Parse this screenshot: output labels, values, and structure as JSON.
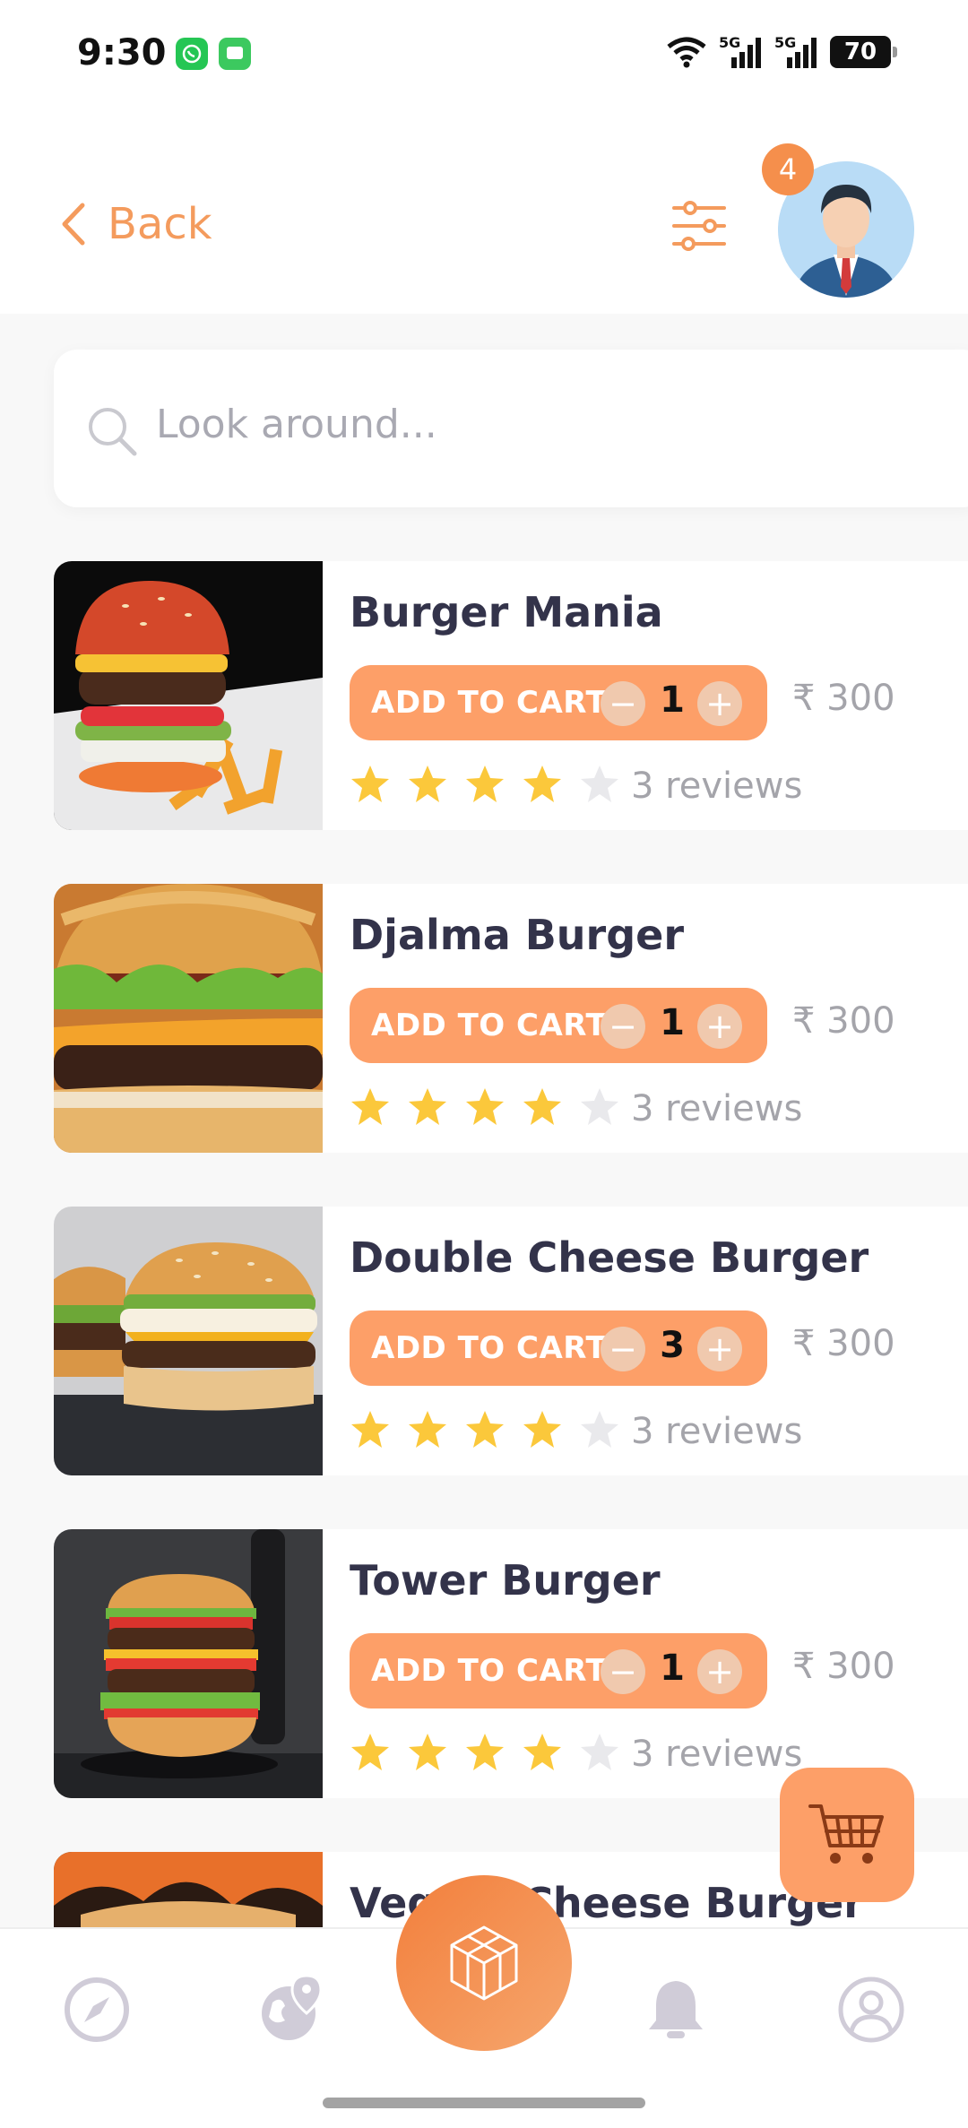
{
  "status": {
    "time": "9:30",
    "net1": "5G",
    "net2": "5G",
    "battery": "70"
  },
  "header": {
    "back_label": "Back",
    "cart_badge": "4"
  },
  "search": {
    "placeholder": "Look around..."
  },
  "add_to_cart_label": "ADD TO CART",
  "items": [
    {
      "name": "Burger Mania",
      "qty": "1",
      "price": "₹ 300",
      "rating": 4,
      "reviews": "3 reviews"
    },
    {
      "name": "Djalma Burger",
      "qty": "1",
      "price": "₹ 300",
      "rating": 4,
      "reviews": "3 reviews"
    },
    {
      "name": "Double Cheese Burger",
      "qty": "3",
      "price": "₹ 300",
      "rating": 4,
      "reviews": "3 reviews"
    },
    {
      "name": "Tower Burger",
      "qty": "1",
      "price": "₹ 300",
      "rating": 4,
      "reviews": "3 reviews"
    },
    {
      "name": "Veggie Cheese Burger"
    }
  ],
  "colors": {
    "accent": "#fd9f68",
    "accent_dark": "#f27f3c",
    "star_on": "#fbc83b",
    "star_off": "#e9e9ec"
  },
  "nav": {
    "icons": [
      "compass-icon",
      "globe-pin-icon",
      "cube-icon",
      "bell-icon",
      "profile-icon"
    ]
  }
}
